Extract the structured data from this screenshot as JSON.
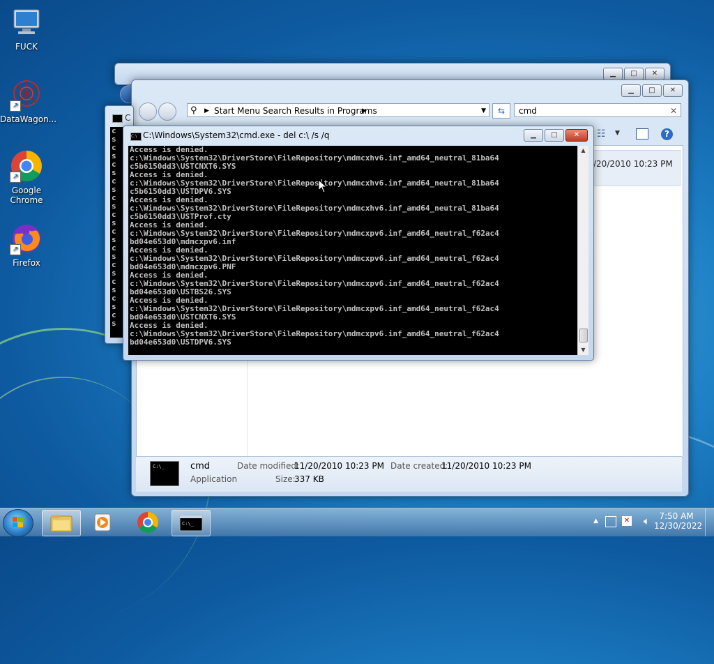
{
  "desktop": {
    "icons": [
      {
        "label": "FUCK"
      },
      {
        "label": "DataWagon..."
      },
      {
        "label": "Google Chrome"
      },
      {
        "label": "Firefox"
      }
    ]
  },
  "explorer": {
    "address": "Start Menu Search Results in Programs",
    "search_value": "cmd",
    "file_date_header": "/20/2010 10:23 PM",
    "details": {
      "name": "cmd",
      "type": "Application",
      "date_modified_label": "Date modified:",
      "date_modified": "11/20/2010 10:23 PM",
      "date_created_label": "Date created:",
      "date_created": "11/20/2010 10:23 PM",
      "size_label": "Size:",
      "size": "337 KB"
    }
  },
  "cmd": {
    "title": "C:\\Windows\\System32\\cmd.exe - del  c:\\ /s /q",
    "lines": [
      "Access is denied.",
      "c:\\Windows\\System32\\DriverStore\\FileRepository\\mdmcxhv6.inf_amd64_neutral_81ba64",
      "c5b6150dd3\\USTCNXT6.SYS",
      "Access is denied.",
      "c:\\Windows\\System32\\DriverStore\\FileRepository\\mdmcxhv6.inf_amd64_neutral_81ba64",
      "c5b6150dd3\\USTDPV6.SYS",
      "Access is denied.",
      "c:\\Windows\\System32\\DriverStore\\FileRepository\\mdmcxhv6.inf_amd64_neutral_81ba64",
      "c5b6150dd3\\USTProf.cty",
      "Access is denied.",
      "c:\\Windows\\System32\\DriverStore\\FileRepository\\mdmcxpv6.inf_amd64_neutral_f62ac4",
      "bd04e653d0\\mdmcxpv6.inf",
      "Access is denied.",
      "c:\\Windows\\System32\\DriverStore\\FileRepository\\mdmcxpv6.inf_amd64_neutral_f62ac4",
      "bd04e653d0\\mdmcxpv6.PNF",
      "Access is denied.",
      "c:\\Windows\\System32\\DriverStore\\FileRepository\\mdmcxpv6.inf_amd64_neutral_f62ac4",
      "bd04e653d0\\USTBS26.SYS",
      "Access is denied.",
      "c:\\Windows\\System32\\DriverStore\\FileRepository\\mdmcxpv6.inf_amd64_neutral_f62ac4",
      "bd04e653d0\\USTCNXT6.SYS",
      "Access is denied.",
      "c:\\Windows\\System32\\DriverStore\\FileRepository\\mdmcxpv6.inf_amd64_neutral_f62ac4",
      "bd04e653d0\\USTDPV6.SYS"
    ]
  },
  "back_cmd": {
    "title_fragment": "C",
    "left_chars": [
      "c",
      "s",
      "c",
      "s",
      "c",
      "s",
      "c",
      "s",
      "c",
      "s",
      "c",
      "s",
      "c",
      "s",
      "c",
      "s",
      "c",
      "s",
      "c",
      "s",
      "c",
      "s",
      "c",
      "s"
    ]
  },
  "taskbar": {
    "time": "7:50 AM",
    "date": "12/30/2022"
  },
  "colors": {
    "console_bg": "#000000",
    "console_text": "#c0c0c0",
    "close_red": "#c23b22"
  }
}
